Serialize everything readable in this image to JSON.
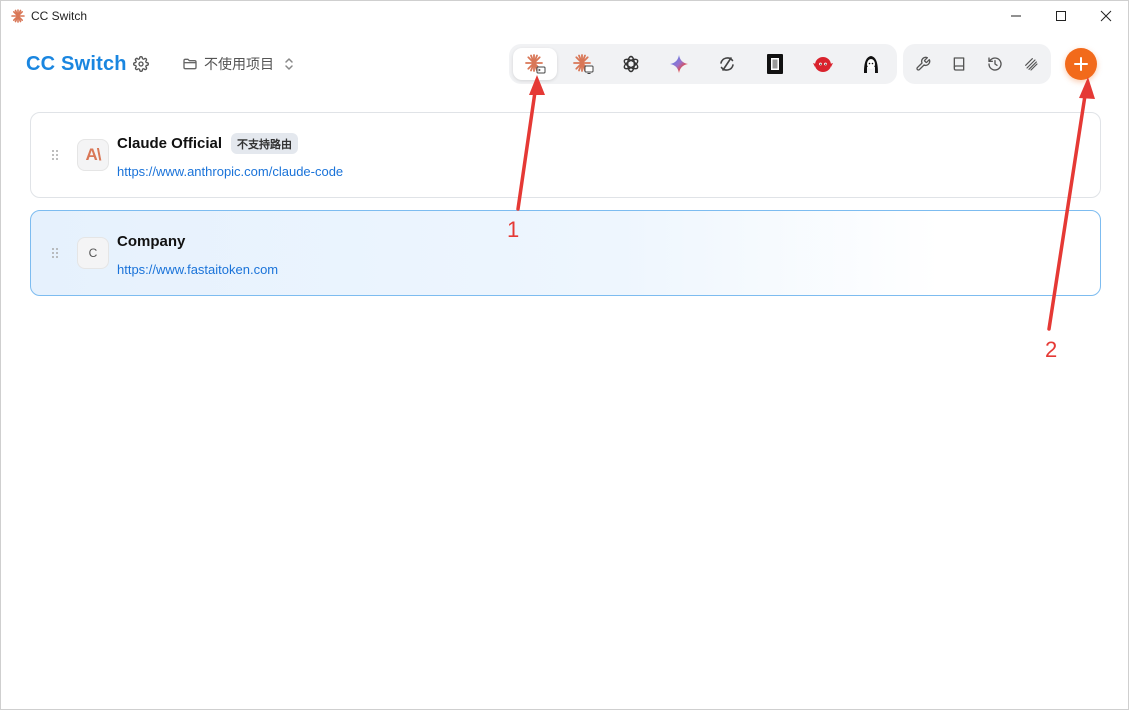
{
  "window": {
    "title": "CC Switch",
    "icons": {
      "app": "claude-burst-icon",
      "minimize": "minimize-icon",
      "maximize": "maximize-icon",
      "close": "close-icon"
    }
  },
  "header": {
    "brand": "CC Switch",
    "settings_icon": "gear-icon",
    "project": {
      "icon": "folder-icon",
      "label": "不使用项目",
      "chevron": "chevron-updown-icon"
    }
  },
  "app_tabs": [
    {
      "id": "claude-code",
      "icon": "claude-terminal-icon",
      "active": true
    },
    {
      "id": "claude-desktop",
      "icon": "claude-desktop-icon",
      "active": false
    },
    {
      "id": "codex",
      "icon": "openai-icon",
      "active": false
    },
    {
      "id": "gemini",
      "icon": "gemini-icon",
      "active": false
    },
    {
      "id": "opencode",
      "icon": "cycle-icon",
      "active": false
    },
    {
      "id": "app6",
      "icon": "square-frame-icon",
      "active": false
    },
    {
      "id": "app7",
      "icon": "red-bird-icon",
      "active": false
    },
    {
      "id": "app8",
      "icon": "avatar-icon",
      "active": false
    }
  ],
  "tools": [
    {
      "id": "tools",
      "icon": "wrench-icon"
    },
    {
      "id": "prompts",
      "icon": "book-icon"
    },
    {
      "id": "history",
      "icon": "history-icon"
    },
    {
      "id": "skills",
      "icon": "layers-icon"
    }
  ],
  "add_button": {
    "icon": "plus-icon"
  },
  "providers": [
    {
      "name": "Claude Official",
      "badge": "不支持路由",
      "url": "https://www.anthropic.com/claude-code",
      "logo_text": "A\\",
      "current": false
    },
    {
      "name": "Company",
      "badge": "",
      "url": "https://www.fastaitoken.com",
      "logo_text": "C",
      "current": true
    }
  ],
  "annotations": [
    {
      "label": "1"
    },
    {
      "label": "2"
    }
  ],
  "colors": {
    "brand": "#1a86e0",
    "accent": "#f26a1b",
    "claude": "#d97757",
    "link": "#1a73d9",
    "annotation": "#e53935"
  }
}
